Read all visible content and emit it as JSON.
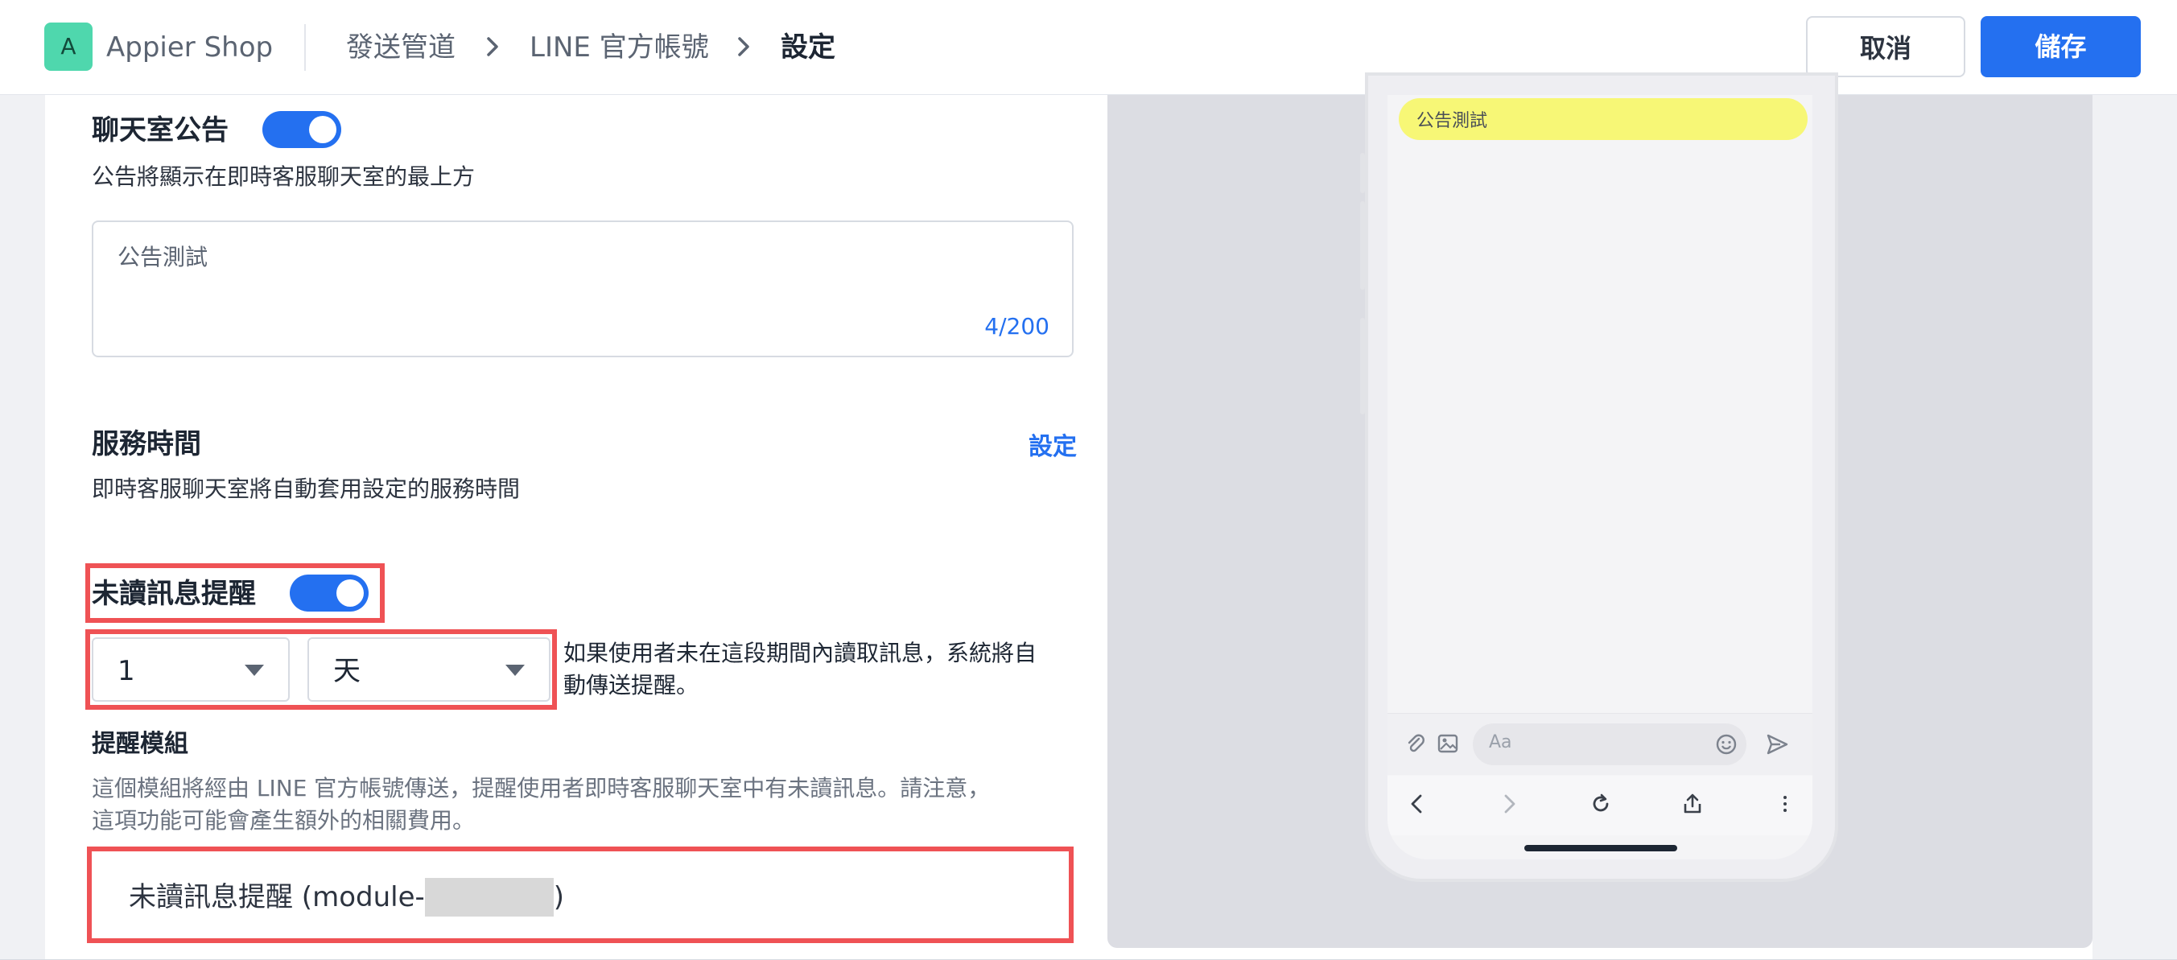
{
  "header": {
    "logo_letter": "A",
    "shop_name": "Appier Shop",
    "breadcrumb": [
      "發送管道",
      "LINE 官方帳號",
      "設定"
    ],
    "cancel_label": "取消",
    "save_label": "儲存"
  },
  "announcement": {
    "title": "聊天室公告",
    "enabled": true,
    "description": "公告將顯示在即時客服聊天室的最上方",
    "value": "公告測試",
    "counter": "4/200"
  },
  "service_hours": {
    "title": "服務時間",
    "link_label": "設定",
    "description": "即時客服聊天室將自動套用設定的服務時間"
  },
  "unread_reminder": {
    "title": "未讀訊息提醒",
    "enabled": true,
    "amount": "1",
    "unit": "天",
    "hint_line1": "如果使用者未在這段期間內讀取訊息，系統將自",
    "hint_line2": "動傳送提醒。"
  },
  "reminder_module": {
    "title": "提醒模組",
    "description_line1": "這個模組將經由 LINE 官方帳號傳送，提醒使用者即時客服聊天室中有未讀訊息。請注意，",
    "description_line2": "這項功能可能會產生額外的相關費用。",
    "value_prefix": "未讀訊息提醒 (module-",
    "value_suffix": ")"
  },
  "preview": {
    "notice_text": "公告測試",
    "input_placeholder": "Aa"
  },
  "colors": {
    "primary": "#2470f0",
    "highlight": "#ef5255",
    "notice": "#f7f776",
    "logo": "#4fd7ad"
  },
  "icons": [
    "chevron-right-icon",
    "chevron-down-icon",
    "paperclip-icon",
    "image-icon",
    "emoji-icon",
    "send-icon",
    "back-icon",
    "forward-icon",
    "reload-icon",
    "share-icon",
    "more-icon"
  ]
}
